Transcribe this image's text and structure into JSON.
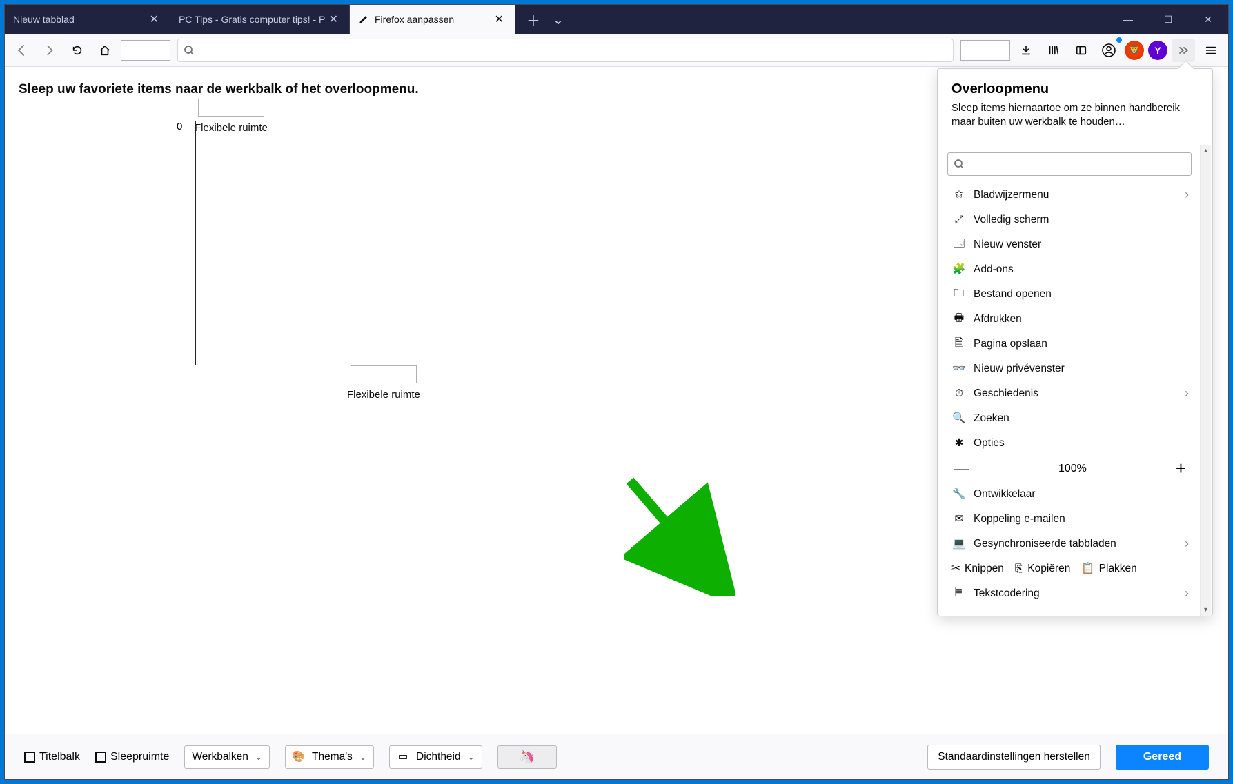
{
  "tabs": [
    {
      "label": "Nieuw tabblad",
      "active": false
    },
    {
      "label": "PC Tips - Gratis computer tips! - PC",
      "active": false
    },
    {
      "label": "Firefox aanpassen",
      "active": true
    }
  ],
  "main": {
    "instruction": "Sleep uw favoriete items naar de werkbalk of het overloopmenu.",
    "flex_label_1": "Flexibele ruimte",
    "flex_label_2": "Flexibele ruimte",
    "zero": "0"
  },
  "overflow": {
    "title": "Overloopmenu",
    "desc": "Sleep items hiernaartoe om ze binnen handbereik maar buiten uw werkbalk te houden…",
    "items": [
      {
        "icon": "bookmark-star",
        "label": "Bladwijzermenu",
        "chevron": true
      },
      {
        "icon": "fullscreen",
        "label": "Volledig scherm",
        "chevron": false
      },
      {
        "icon": "window-new",
        "label": "Nieuw venster",
        "chevron": false
      },
      {
        "icon": "addons",
        "label": "Add-ons",
        "chevron": false
      },
      {
        "icon": "open-file",
        "label": "Bestand openen",
        "chevron": false
      },
      {
        "icon": "print",
        "label": "Afdrukken",
        "chevron": false
      },
      {
        "icon": "save-page",
        "label": "Pagina opslaan",
        "chevron": false
      },
      {
        "icon": "private",
        "label": "Nieuw privévenster",
        "chevron": false
      },
      {
        "icon": "history",
        "label": "Geschiedenis",
        "chevron": true
      },
      {
        "icon": "search",
        "label": "Zoeken",
        "chevron": false
      },
      {
        "icon": "settings",
        "label": "Opties",
        "chevron": false
      }
    ],
    "zoom": {
      "minus": "—",
      "value": "100%",
      "plus": "+"
    },
    "items2": [
      {
        "icon": "developer",
        "label": "Ontwikkelaar",
        "chevron": false
      },
      {
        "icon": "email",
        "label": "Koppeling e-mailen",
        "chevron": false
      },
      {
        "icon": "synced",
        "label": "Gesynchroniseerde tabbladen",
        "chevron": true
      }
    ],
    "ccp": {
      "cut": "Knippen",
      "copy": "Kopiëren",
      "paste": "Plakken"
    },
    "items3": [
      {
        "icon": "text-enc",
        "label": "Tekstcodering",
        "chevron": true
      }
    ]
  },
  "footer": {
    "titlebar": "Titelbalk",
    "dragspace": "Sleepruimte",
    "toolbars": "Werkbalken",
    "themes": "Thema's",
    "density": "Dichtheid",
    "unicorn": "🦄",
    "restore": "Standaardinstellingen herstellen",
    "done": "Gereed"
  }
}
